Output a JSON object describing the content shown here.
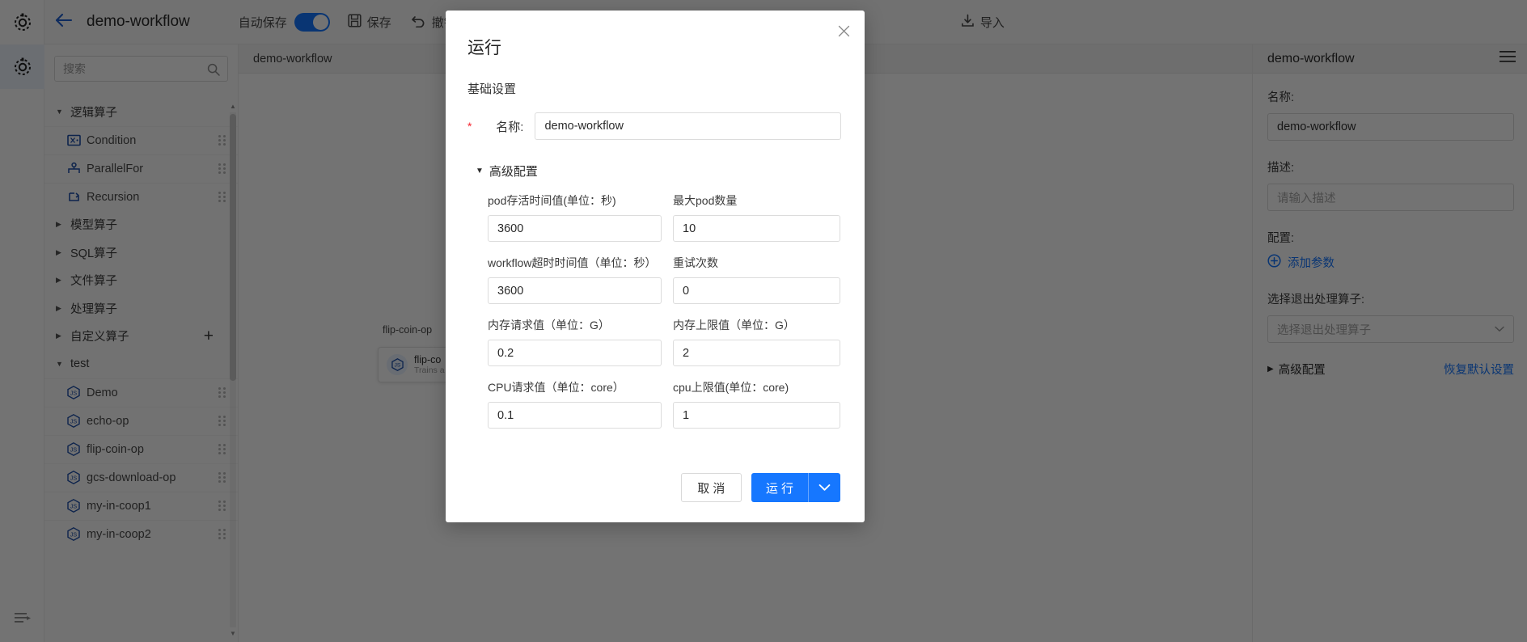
{
  "rail": {
    "top_icon": "settings-gear-icon",
    "active_icon": "workflow-gear-icon",
    "bottom_icon": "collapse-panel-icon"
  },
  "topbar": {
    "back_icon": "back-arrow-icon",
    "workflow_name": "demo-workflow",
    "autosave_label": "自动保存",
    "save_label": "保存",
    "undo_label": "撤销",
    "import_label": "导入"
  },
  "left_panel": {
    "search": {
      "placeholder": "搜索",
      "value": "",
      "icon": "search-icon"
    },
    "groups": [
      {
        "label": "逻辑算子",
        "expanded": true,
        "items": [
          {
            "label": "Condition",
            "icon": "condition-icon"
          },
          {
            "label": "ParallelFor",
            "icon": "parallel-for-icon"
          },
          {
            "label": "Recursion",
            "icon": "recursion-icon"
          }
        ]
      },
      {
        "label": "模型算子",
        "expanded": false,
        "items": []
      },
      {
        "label": "SQL算子",
        "expanded": false,
        "items": []
      },
      {
        "label": "文件算子",
        "expanded": false,
        "items": []
      },
      {
        "label": "处理算子",
        "expanded": false,
        "items": []
      },
      {
        "label": "自定义算子",
        "expanded": false,
        "add_label": "+",
        "items": []
      },
      {
        "label": "test",
        "expanded": true,
        "items": [
          {
            "label": "Demo",
            "icon": "js-icon"
          },
          {
            "label": "echo-op",
            "icon": "js-icon"
          },
          {
            "label": "flip-coin-op",
            "icon": "js-icon"
          },
          {
            "label": "gcs-download-op",
            "icon": "js-icon"
          },
          {
            "label": "my-in-coop1",
            "icon": "js-icon"
          },
          {
            "label": "my-in-coop2",
            "icon": "js-icon"
          }
        ]
      }
    ]
  },
  "canvas": {
    "tab_label": "demo-workflow",
    "node_caption": "flip-coin-op",
    "node": {
      "title": "flip-co",
      "subtitle": "Trains a"
    }
  },
  "right_panel": {
    "title": "demo-workflow",
    "menu_icon": "hamburger-icon",
    "name_label": "名称:",
    "name_value": "demo-workflow",
    "desc_label": "描述:",
    "desc_placeholder": "请输入描述",
    "config_label": "配置:",
    "add_param_label": "添加参数",
    "add_param_icon": "plus-circle-icon",
    "exit_handler_label": "选择退出处理算子:",
    "exit_handler_placeholder": "选择退出处理算子",
    "advanced_label": "高级配置",
    "reset_label": "恢复默认设置"
  },
  "modal": {
    "title": "运行",
    "close_icon": "close-icon",
    "section_basic": "基础设置",
    "name_required_mark": "*",
    "name_label": "名称:",
    "name_value": "demo-workflow",
    "advanced_label": "高级配置",
    "advanced_expanded": true,
    "fields": [
      {
        "label": "pod存活时间值(单位：秒)",
        "value": "3600"
      },
      {
        "label": "最大pod数量",
        "value": "10"
      },
      {
        "label": "workflow超时时间值（单位：秒）",
        "value": "3600"
      },
      {
        "label": "重试次数",
        "value": "0"
      },
      {
        "label": "内存请求值（单位：G）",
        "value": "0.2"
      },
      {
        "label": "内存上限值（单位：G）",
        "value": "2"
      },
      {
        "label": "CPU请求值（单位：core）",
        "value": "0.1"
      },
      {
        "label": "cpu上限值(单位：core)",
        "value": "1"
      }
    ],
    "cancel_label": "取 消",
    "run_label": "运 行",
    "run_caret_icon": "chevron-down-icon"
  },
  "colors": {
    "primary": "#1677ff",
    "required": "#f5222d",
    "overlay": "rgba(0,0,0,0.55)"
  }
}
